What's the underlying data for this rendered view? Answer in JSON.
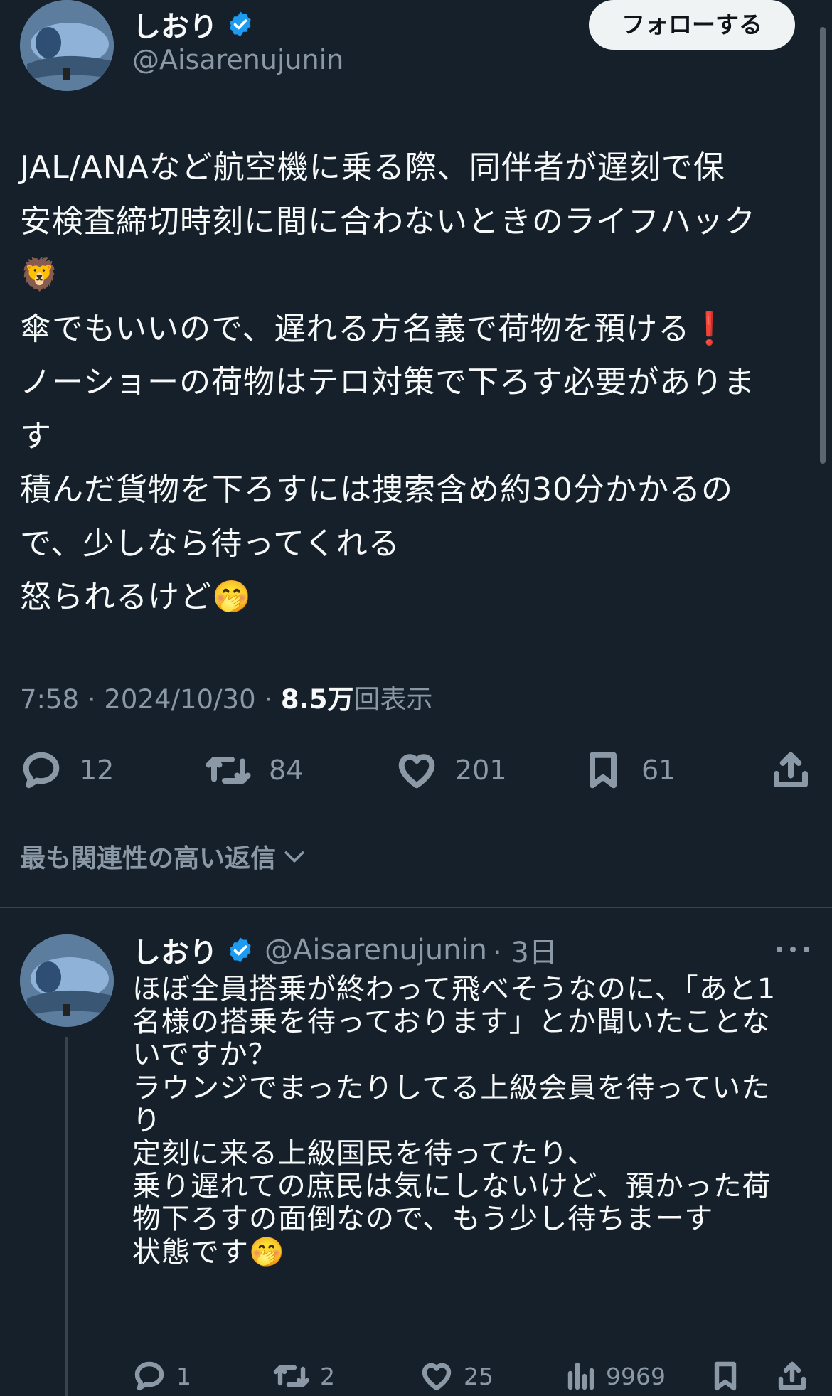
{
  "tweet": {
    "author_name": "しおり",
    "author_handle": "@Aisarenujunin",
    "follow_label": "フォローする",
    "body": "JAL/ANAなど航空機に乗る際、同伴者が遅刻で保\n安検査締切時刻に間に合わないときのライフハック\n🦁\n傘でもいいので、遅れる方名義で荷物を預ける❗\nノーショーの荷物はテロ対策で下ろす必要がありま\nす\n積んだ貨物を下ろすには捜索含め約30分かかるの\nで、少しなら待ってくれる\n怒られるけど🤭",
    "time": "7:58 · 2024/10/30 · ",
    "views_value": "8.5万",
    "views_label": "回表示",
    "stats": {
      "replies": "12",
      "retweets": "84",
      "likes": "201",
      "bookmarks": "61"
    }
  },
  "sort_label": "最も関連性の高い返信",
  "reply": {
    "author_name": "しおり",
    "author_handle": "@Aisarenujunin",
    "age": "· 3日",
    "body": "ほぼ全員搭乗が終わって飛べそうなのに、「あと1\n名様の搭乗を待っております」とか聞いたことな\nいですか？\nラウンジでまったりしてる上級会員を待っていた\nり\n定刻に来る上級国民を待ってたり、\n乗り遅れての庶民は気にしないけど、預かった荷\n物下ろすの面倒なので、もう少し待ちまーす\n状態です🤭",
    "stats": {
      "replies": "1",
      "retweets": "2",
      "likes": "25",
      "views": "9969"
    }
  },
  "colors": {
    "background": "#15202b",
    "text": "#f7f9f9",
    "muted": "#8b98a5",
    "verified": "#1d9bf0",
    "follow_bg": "#eff3f4"
  }
}
